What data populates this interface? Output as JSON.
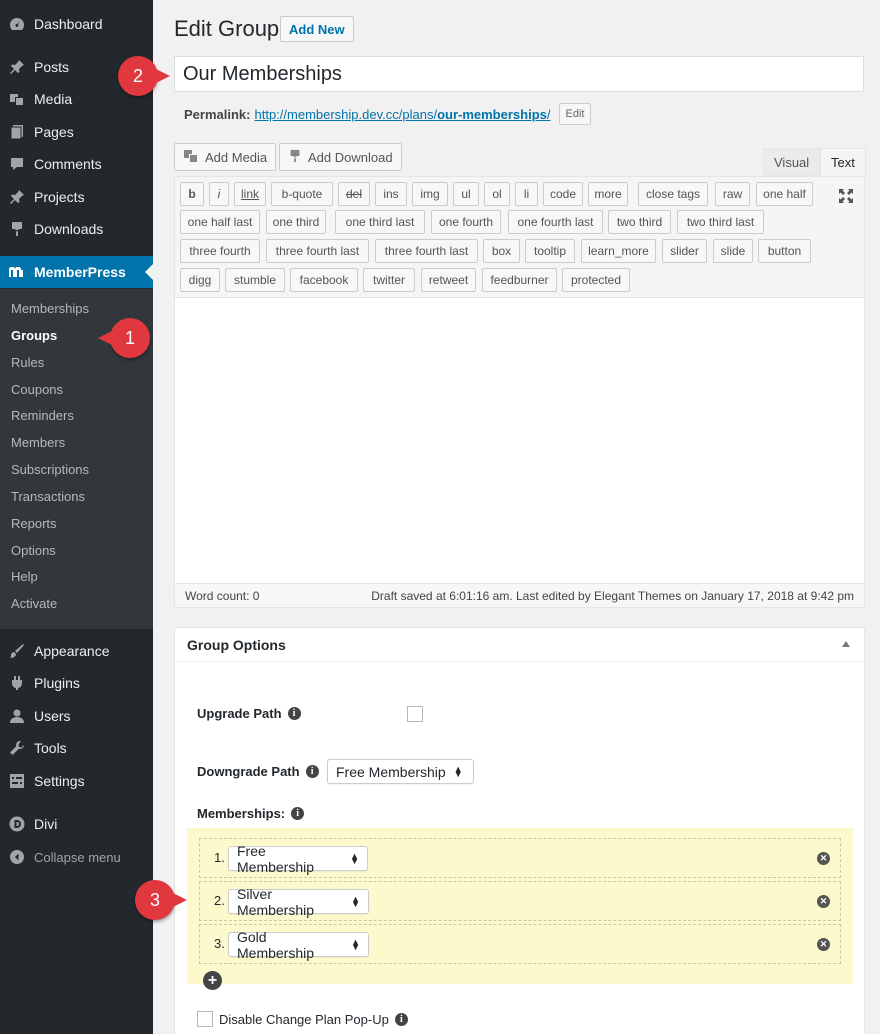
{
  "sidebar": {
    "items": [
      {
        "label": "Dashboard",
        "icon": "dashboard-icon"
      },
      {
        "label": "Posts",
        "icon": "pin-icon"
      },
      {
        "label": "Media",
        "icon": "media-icon"
      },
      {
        "label": "Pages",
        "icon": "pages-icon"
      },
      {
        "label": "Comments",
        "icon": "comment-icon"
      },
      {
        "label": "Projects",
        "icon": "pin-icon"
      },
      {
        "label": "Downloads",
        "icon": "download-icon"
      },
      {
        "label": "MemberPress",
        "icon": "memberpress-icon"
      },
      {
        "label": "Appearance",
        "icon": "brush-icon"
      },
      {
        "label": "Plugins",
        "icon": "plugin-icon"
      },
      {
        "label": "Users",
        "icon": "user-icon"
      },
      {
        "label": "Tools",
        "icon": "wrench-icon"
      },
      {
        "label": "Settings",
        "icon": "settings-icon"
      },
      {
        "label": "Divi",
        "icon": "divi-icon"
      }
    ],
    "submenu": [
      "Memberships",
      "Groups",
      "Rules",
      "Coupons",
      "Reminders",
      "Members",
      "Subscriptions",
      "Transactions",
      "Reports",
      "Options",
      "Help",
      "Activate"
    ],
    "collapse_label": "Collapse menu"
  },
  "callouts": {
    "one": "1",
    "two": "2",
    "three": "3"
  },
  "header": {
    "title": "Edit Group",
    "add_new": "Add New"
  },
  "title_value": "Our Memberships",
  "permalink": {
    "label": "Permalink:",
    "url_base": "http://membership.dev.cc/plans/",
    "slug": "our-memberships",
    "url_end": "/",
    "edit": "Edit"
  },
  "media": {
    "add_media": "Add Media",
    "add_download": "Add Download"
  },
  "editor_tabs": {
    "visual": "Visual",
    "text": "Text"
  },
  "quicktags": [
    [
      "b",
      "i",
      "link",
      "b-quote",
      "del",
      "ins",
      "img",
      "ul",
      "ol",
      "li",
      "code",
      "more",
      "close tags",
      "raw",
      "one half"
    ],
    [
      "one half last",
      "one third",
      "one third last",
      "one fourth",
      "one fourth last",
      "two third",
      "two third last"
    ],
    [
      "three fourth",
      "three fourth last",
      "three fourth last",
      "box",
      "tooltip",
      "learn_more",
      "slider",
      "slide",
      "button"
    ],
    [
      "digg",
      "stumble",
      "facebook",
      "twitter",
      "retweet",
      "feedburner",
      "protected"
    ]
  ],
  "status": {
    "word_count": "Word count: 0",
    "draft": "Draft saved at 6:01:16 am. Last edited by Elegant Themes on January 17, 2018 at 9:42 pm"
  },
  "options": {
    "title": "Group Options",
    "upgrade_path": "Upgrade Path",
    "downgrade_path": "Downgrade Path",
    "downgrade_value": "Free Membership",
    "memberships_label": "Memberships:",
    "memberships": [
      {
        "num": "1.",
        "value": "Free Membership"
      },
      {
        "num": "2.",
        "value": "Silver Membership"
      },
      {
        "num": "3.",
        "value": "Gold Membership"
      }
    ],
    "disable_popup": "Disable Change Plan Pop-Up"
  }
}
